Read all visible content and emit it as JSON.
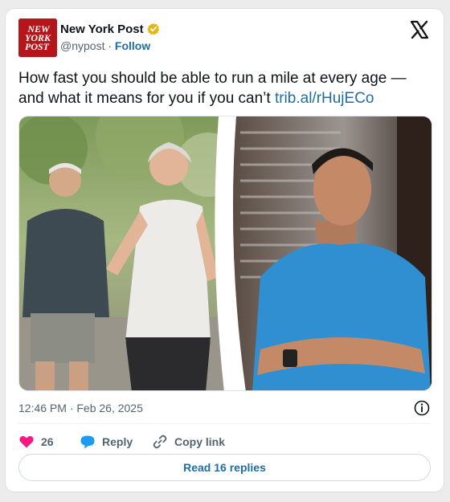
{
  "account": {
    "logo_text": [
      "NEW",
      "YORK",
      "POST"
    ],
    "name": "New York Post",
    "handle": "@nypost",
    "separator": " · ",
    "follow_label": "Follow"
  },
  "tweet": {
    "text": "How fast you should be able to run a mile at every age — and what it means for you if you can’t ",
    "link": "trib.al/rHujECo"
  },
  "media": {
    "alt": "Older couple jogging and a young man in a blue t-shirt with arms crossed"
  },
  "meta": {
    "timestamp": "12:46 PM · Feb 26, 2025"
  },
  "actions": {
    "likes": "26",
    "reply_label": "Reply",
    "copy_label": "Copy link"
  },
  "replies_button": "Read 16 replies",
  "colors": {
    "brand_red": "#b5161b",
    "link_blue": "#1d6fa3",
    "like_pink": "#f91880",
    "reply_blue": "#1d9bf0",
    "verified_gold": "#e2b719"
  },
  "icons": [
    "verified-badge-icon",
    "x-logo-icon",
    "heart-icon",
    "reply-bubble-icon",
    "link-icon",
    "info-icon"
  ]
}
